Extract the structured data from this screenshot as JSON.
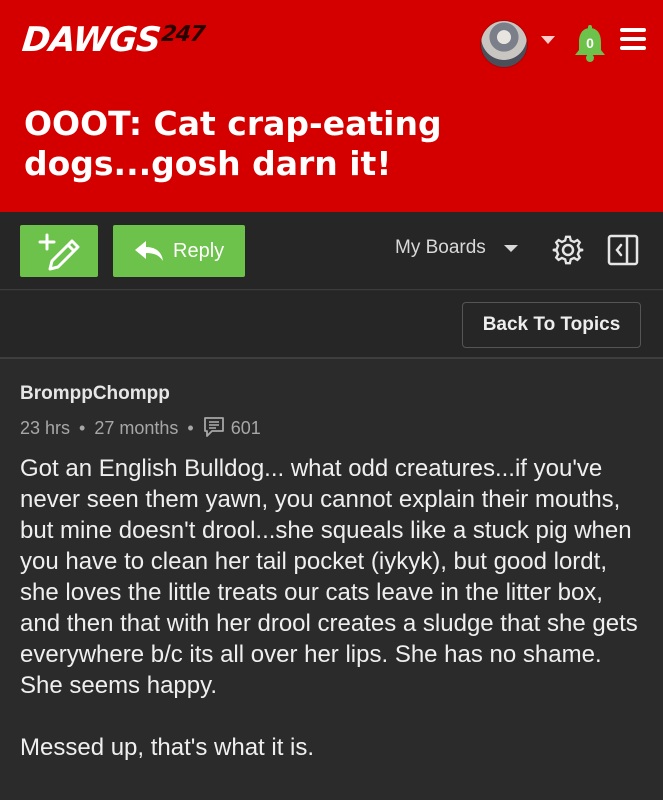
{
  "header": {
    "logo_main": "DAWGS",
    "logo_sup": "247",
    "notification_count": "0",
    "colors": {
      "brand_red": "#d40000",
      "accent_green": "#6cc24a",
      "dark_bg": "#2b2b2b"
    }
  },
  "topic": {
    "title": "OOOT: Cat crap-eating dogs...gosh darn it!"
  },
  "toolbar": {
    "new_topic_icon": "pencil-plus-icon",
    "reply_label": "Reply",
    "my_boards_label": "My Boards",
    "settings_icon": "gear-icon",
    "collapse_icon": "sidebar-collapse-icon"
  },
  "subbar": {
    "back_label": "Back To Topics"
  },
  "post": {
    "author": "BromppChompp",
    "time_ago": "23 hrs",
    "member_since": "27 months",
    "post_count": "601",
    "paragraphs": [
      "Got an English Bulldog... what odd creatures...if you've never seen them yawn, you cannot explain their mouths, but mine doesn't drool...she squeals like a stuck pig when you have to clean her tail pocket (iykyk), but good lordt, she loves the little treats our cats leave in the litter box, and then that with her drool creates a sludge that she gets everywhere b/c its all over her lips. She has no shame. She seems happy.",
      "Messed up, that's what it is."
    ]
  }
}
